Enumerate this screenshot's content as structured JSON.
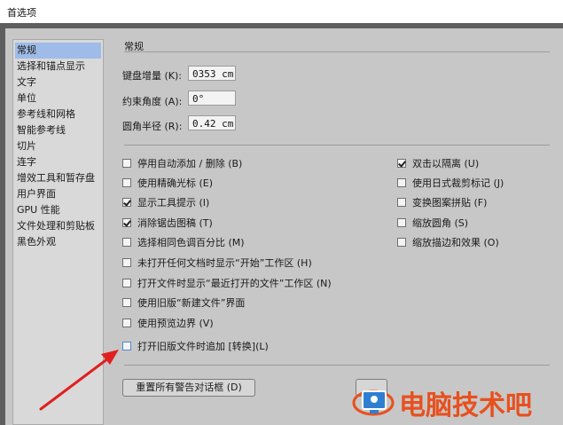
{
  "window": {
    "title": "首选项"
  },
  "sidebar": {
    "items": [
      {
        "label": "常规",
        "selected": true
      },
      {
        "label": "选择和锚点显示"
      },
      {
        "label": "文字"
      },
      {
        "label": "单位"
      },
      {
        "label": "参考线和网格"
      },
      {
        "label": "智能参考线"
      },
      {
        "label": "切片"
      },
      {
        "label": "连字"
      },
      {
        "label": "增效工具和暂存盘"
      },
      {
        "label": "用户界面"
      },
      {
        "label": "GPU 性能"
      },
      {
        "label": "文件处理和剪贴板"
      },
      {
        "label": "黑色外观"
      }
    ]
  },
  "general": {
    "heading": "常规",
    "keyboard_increment": {
      "label": "键盘增量 (K):",
      "value": "0353 cm"
    },
    "constrain_angle": {
      "label": "约束角度 (A):",
      "value": "0°"
    },
    "corner_radius": {
      "label": "圆角半径 (R):",
      "value": "0.42 cm"
    }
  },
  "options_left": [
    {
      "label": "停用自动添加 / 删除 (B)",
      "checked": false
    },
    {
      "label": "使用精确光标 (E)",
      "checked": false
    },
    {
      "label": "显示工具提示 (I)",
      "checked": true
    },
    {
      "label": "消除锯齿图稿 (T)",
      "checked": true
    },
    {
      "label": "选择相同色调百分比 (M)",
      "checked": false
    },
    {
      "label": "未打开任何文档时显示“开始”工作区 (H)",
      "checked": false
    },
    {
      "label": "打开文件时显示“最近打开的文件”工作区 (N)",
      "checked": false
    },
    {
      "label": "使用旧版“新建文件”界面",
      "checked": false
    },
    {
      "label": "使用预览边界 (V)",
      "checked": false
    }
  ],
  "options_right": [
    {
      "label": "双击以隔离 (U)",
      "checked": true
    },
    {
      "label": "使用日式裁剪标记 (J)",
      "checked": false
    },
    {
      "label": "变换图案拼贴 (F)",
      "checked": false
    },
    {
      "label": "缩放圆角 (S)",
      "checked": false
    },
    {
      "label": "缩放描边和效果 (O)",
      "checked": false
    }
  ],
  "legacy_option": {
    "label": "打开旧版文件时追加 [转换](L)",
    "checked": false
  },
  "reset_button": {
    "label": "重置所有警告对话框 (D)"
  },
  "watermark": {
    "text": "电脑技术吧"
  },
  "colors": {
    "accent": "#e8501e",
    "selection": "#9fbce8",
    "arrow": "#e02020"
  }
}
